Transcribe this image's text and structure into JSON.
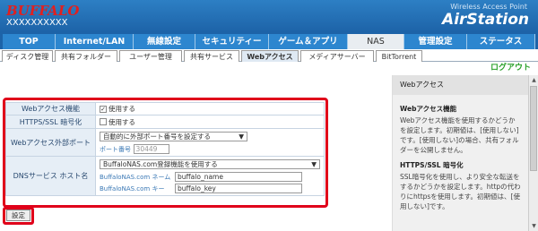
{
  "header": {
    "brand": "BUFFALO",
    "model": "XXXXXXXXXX",
    "product_sub": "Wireless Access Point",
    "product_main": "AirStation"
  },
  "nav": {
    "tabs": [
      "TOP",
      "Internet/LAN",
      "無線設定",
      "セキュリティー",
      "ゲーム＆アプリ",
      "NAS",
      "管理設定",
      "ステータス"
    ],
    "active": "NAS"
  },
  "subnav": {
    "tabs": [
      "ディスク管理",
      "共有フォルダー",
      "ユーザー管理",
      "共有サービス",
      "Webアクセス",
      "メディアサーバー",
      "BitTorrent"
    ],
    "active": "Webアクセス"
  },
  "logout": "ログアウト",
  "form": {
    "web_access": {
      "label": "Webアクセス機能",
      "option": "使用する",
      "checked": true
    },
    "https": {
      "label": "HTTPS/SSL 暗号化",
      "option": "使用する",
      "checked": false
    },
    "ext_port": {
      "label": "Webアクセス外部ポート",
      "select": "自動的に外部ポート番号を設定する",
      "port_label": "ポート番号",
      "port_value": "30449"
    },
    "dns": {
      "label": "DNSサービス ホスト名",
      "select": "BuffaloNAS.com登録機能を使用する",
      "name_label": "BuffaloNAS.com ネーム",
      "name_value": "buffalo_name",
      "key_label": "BuffaloNAS.com キー",
      "key_value": "buffalo_key"
    },
    "submit": "設定"
  },
  "help": {
    "title": "Webアクセス",
    "s1_title": "Webアクセス機能",
    "s1_text": "Webアクセス機能を使用するかどうかを設定します。初期値は、[使用しない]です。[使用しない]の場合、共有フォルダーを公開しません。",
    "s2_title": "HTTPS/SSL 暗号化",
    "s2_text": "SSL暗号化を使用し、より安全な転送をするかどうかを設定します。httpの代わりにhttpsを使用します。初期値は、[使用しない]です。"
  }
}
